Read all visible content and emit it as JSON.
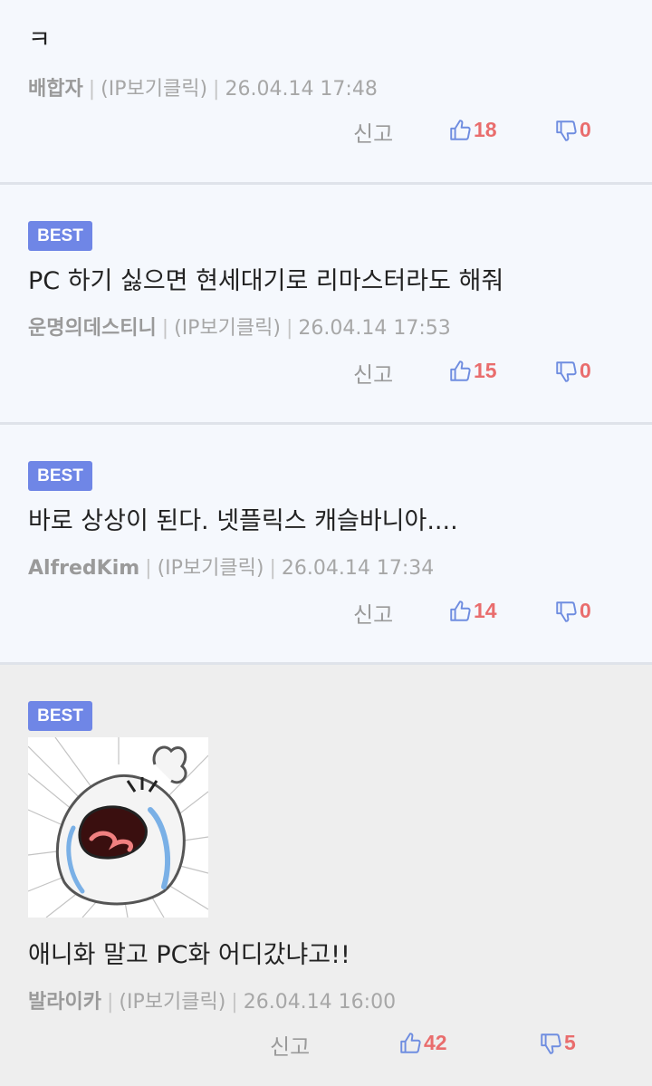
{
  "comments": [
    {
      "text": "ㅋ",
      "author": "배합자",
      "ip": "(IP보기클릭)",
      "date": "26.04.14 17:48",
      "report": "신고",
      "up": "18",
      "down": "0"
    },
    {
      "best": "BEST",
      "text": "PC 하기 싫으면 현세대기로 리마스터라도 해줘",
      "author": "운명의데스티니",
      "ip": "(IP보기클릭)",
      "date": "26.04.14 17:53",
      "report": "신고",
      "up": "15",
      "down": "0"
    },
    {
      "best": "BEST",
      "text": "바로 상상이 된다. 넷플릭스 캐슬바니아....",
      "author": "AlfredKim",
      "ip": "(IP보기클릭)",
      "date": "26.04.14 17:34",
      "report": "신고",
      "up": "14",
      "down": "0"
    },
    {
      "best": "BEST",
      "text": "애니화 말고 PC화 어디갔냐고!!",
      "author": "발라이카",
      "ip": "(IP보기클릭)",
      "date": "26.04.14 16:00",
      "report": "신고",
      "up": "42",
      "down": "5",
      "image": "crying-emoticon"
    }
  ],
  "colors": {
    "best_badge": "#6f86e6",
    "vote_count": "#e96d6d",
    "thumb_icon": "#6f8de0"
  },
  "icons": {
    "thumbs_up": "thumbs-up-icon",
    "thumbs_down": "thumbs-down-icon"
  }
}
